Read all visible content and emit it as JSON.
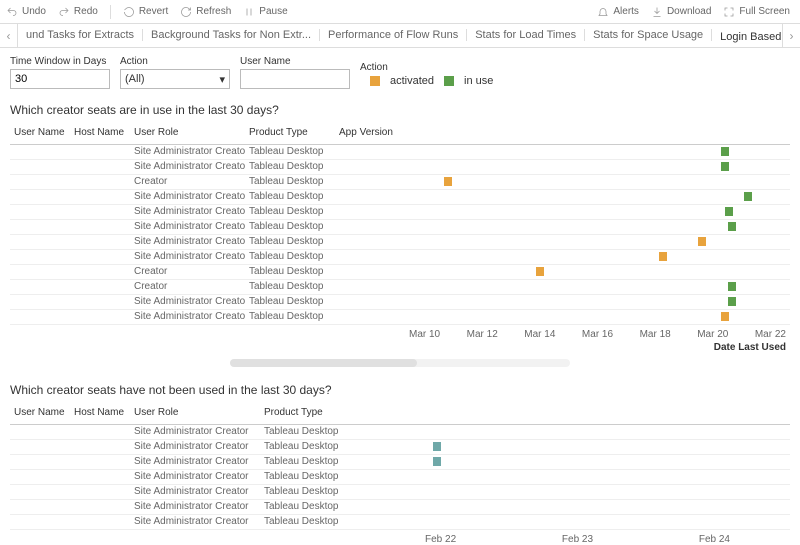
{
  "toolbar": {
    "undo": "Undo",
    "redo": "Redo",
    "revert": "Revert",
    "refresh": "Refresh",
    "pause": "Pause",
    "alerts": "Alerts",
    "download": "Download",
    "fullscreen": "Full Screen"
  },
  "tabs": {
    "items": [
      {
        "label": "und Tasks for Extracts",
        "active": false
      },
      {
        "label": "Background Tasks for Non Extr...",
        "active": false
      },
      {
        "label": "Performance of Flow Runs",
        "active": false
      },
      {
        "label": "Stats for Load Times",
        "active": false
      },
      {
        "label": "Stats for Space Usage",
        "active": false
      },
      {
        "label": "Login Based License Usage",
        "active": true
      }
    ]
  },
  "filters": {
    "days_label": "Time Window in Days",
    "days_value": "30",
    "action_label": "Action",
    "action_value": "(All)",
    "user_label": "User Name",
    "user_value": "",
    "legend_label": "Action",
    "legend_items": [
      {
        "key": "activated",
        "label": "activated",
        "color": "#e8a33d"
      },
      {
        "key": "inuse",
        "label": "in use",
        "color": "#5b9f4a"
      }
    ]
  },
  "section1": {
    "title": "Which creator seats are in use in the last 30 days?",
    "headers": {
      "user": "User Name",
      "host": "Host Name",
      "role": "User Role",
      "prod": "Product Type",
      "app": "App Version"
    },
    "axis_label": "Date Last Used",
    "axis_ticks": [
      "Mar 10",
      "Mar 12",
      "Mar 14",
      "Mar 16",
      "Mar 18",
      "Mar 20",
      "Mar 22"
    ]
  },
  "section2": {
    "title": "Which creator seats have not been used in the last 30 days?",
    "headers": {
      "user": "User Name",
      "host": "Host Name",
      "role": "User Role",
      "prod": "Product Type"
    },
    "axis_ticks": [
      "Feb 22",
      "Feb 23",
      "Feb 24"
    ]
  },
  "chart_data": [
    {
      "type": "scatter",
      "title": "Which creator seats are in use in the last 30 days?",
      "x_axis": {
        "label": "Date Last Used",
        "range": [
          "Mar 10",
          "Mar 22"
        ]
      },
      "series_colors": {
        "activated": "#e8a33d",
        "in use": "#5b9f4a"
      },
      "rows": [
        {
          "user": "",
          "host": "",
          "role": "Site Administrator Creator",
          "product": "Tableau Desktop",
          "app": "",
          "action": "in use",
          "date": "Mar 20",
          "pct": 82
        },
        {
          "user": "",
          "host": "",
          "role": "Site Administrator Creator",
          "product": "Tableau Desktop",
          "app": "",
          "action": "in use",
          "date": "Mar 20",
          "pct": 82
        },
        {
          "user": "",
          "host": "",
          "role": "Creator",
          "product": "Tableau Desktop",
          "app": "",
          "action": "activated",
          "date": "Mar 11",
          "pct": 10
        },
        {
          "user": "",
          "host": "",
          "role": "Site Administrator Creator",
          "product": "Tableau Desktop",
          "app": "",
          "action": "in use",
          "date": "Mar 21",
          "pct": 88
        },
        {
          "user": "",
          "host": "",
          "role": "Site Administrator Creator",
          "product": "Tableau Desktop",
          "app": "",
          "action": "in use",
          "date": "Mar 20",
          "pct": 83
        },
        {
          "user": "",
          "host": "",
          "role": "Site Administrator Creator",
          "product": "Tableau Desktop",
          "app": "",
          "action": "in use",
          "date": "Mar 20",
          "pct": 84
        },
        {
          "user": "",
          "host": "",
          "role": "Site Administrator Creator",
          "product": "Tableau Desktop",
          "app": "",
          "action": "activated",
          "date": "Mar 19",
          "pct": 76
        },
        {
          "user": "",
          "host": "",
          "role": "Site Administrator Creator",
          "product": "Tableau Desktop",
          "app": "",
          "action": "activated",
          "date": "Mar 18",
          "pct": 66
        },
        {
          "user": "",
          "host": "",
          "role": "Creator",
          "product": "Tableau Desktop",
          "app": "",
          "action": "activated",
          "date": "Mar 14",
          "pct": 34
        },
        {
          "user": "",
          "host": "",
          "role": "Creator",
          "product": "Tableau Desktop",
          "app": "",
          "action": "in use",
          "date": "Mar 20",
          "pct": 84
        },
        {
          "user": "",
          "host": "",
          "role": "Site Administrator Creator",
          "product": "Tableau Desktop",
          "app": "",
          "action": "in use",
          "date": "Mar 20",
          "pct": 84
        },
        {
          "user": "",
          "host": "",
          "role": "Site Administrator Creator",
          "product": "Tableau Desktop",
          "app": "",
          "action": "activated",
          "date": "Mar 20",
          "pct": 82
        }
      ]
    },
    {
      "type": "scatter",
      "title": "Which creator seats have not been used in the last 30 days?",
      "x_axis": {
        "range": [
          "Feb 22",
          "Feb 24"
        ]
      },
      "series_colors": {
        "not used": "#6fa8a8"
      },
      "rows": [
        {
          "user": "",
          "host": "",
          "role": "Site Administrator Creator",
          "product": "Tableau Desktop",
          "action": null,
          "date": null,
          "pct": null
        },
        {
          "user": "",
          "host": "",
          "role": "Site Administrator Creator",
          "product": "Tableau Desktop",
          "action": "not used",
          "date": "Feb 22",
          "pct": 16
        },
        {
          "user": "",
          "host": "",
          "role": "Site Administrator Creator",
          "product": "Tableau Desktop",
          "action": "not used",
          "date": "Feb 22",
          "pct": 16
        },
        {
          "user": "",
          "host": "",
          "role": "Site Administrator Creator",
          "product": "Tableau Desktop",
          "action": null,
          "date": null,
          "pct": null
        },
        {
          "user": "",
          "host": "",
          "role": "Site Administrator Creator",
          "product": "Tableau Desktop",
          "action": null,
          "date": null,
          "pct": null
        },
        {
          "user": "",
          "host": "",
          "role": "Site Administrator Creator",
          "product": "Tableau Desktop",
          "action": null,
          "date": null,
          "pct": null
        },
        {
          "user": "",
          "host": "",
          "role": "Site Administrator Creator",
          "product": "Tableau Desktop",
          "action": null,
          "date": null,
          "pct": null
        }
      ]
    }
  ]
}
